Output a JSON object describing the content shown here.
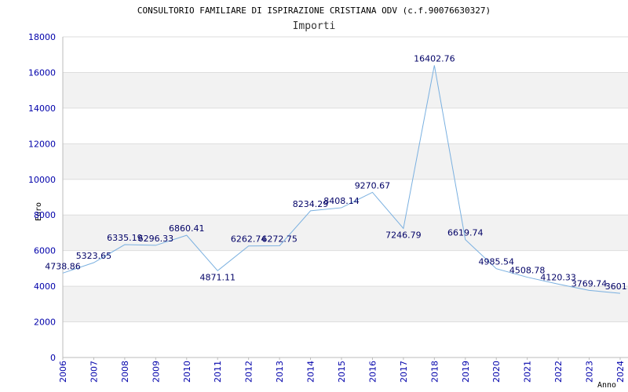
{
  "chart_data": {
    "type": "line",
    "title": "CONSULTORIO FAMILIARE DI ISPIRAZIONE CRISTIANA ODV (c.f.90076630327)",
    "subtitle": "Importi",
    "xlabel": "Anno",
    "ylabel": "Euro",
    "ylim": [
      0,
      18000
    ],
    "yticks": [
      "0",
      "2000",
      "4000",
      "6000",
      "8000",
      "10000",
      "12000",
      "14000",
      "16000",
      "18000"
    ],
    "categories": [
      "2006",
      "2007",
      "2008",
      "2009",
      "2010",
      "2011",
      "2012",
      "2013",
      "2014",
      "2015",
      "2016",
      "2017",
      "2018",
      "2019",
      "2020",
      "2021",
      "2022",
      "2023",
      "2024"
    ],
    "values": [
      4738.86,
      5323.65,
      6335.19,
      6296.33,
      6860.41,
      4871.11,
      6262.74,
      6272.75,
      8234.29,
      8408.14,
      9270.67,
      7246.79,
      16402.76,
      6619.74,
      4985.54,
      4508.78,
      4120.33,
      3769.74,
      3601.0
    ],
    "value_labels": [
      "4738.86",
      "5323.65",
      "6335.19",
      "6296.33",
      "6860.41",
      "4871.11",
      "6262.74",
      "6272.75",
      "8234.29",
      "8408.14",
      "9270.67",
      "7246.79",
      "16402.76",
      "6619.74",
      "4985.54",
      "4508.78",
      "4120.33",
      "3769.74",
      "3601.0"
    ],
    "grid": true,
    "band_colors": [
      "#ffffff",
      "#f2f2f2"
    ],
    "line_color": "#7ab0e0",
    "tick_color": "#0000aa",
    "label_color": "#000066"
  }
}
